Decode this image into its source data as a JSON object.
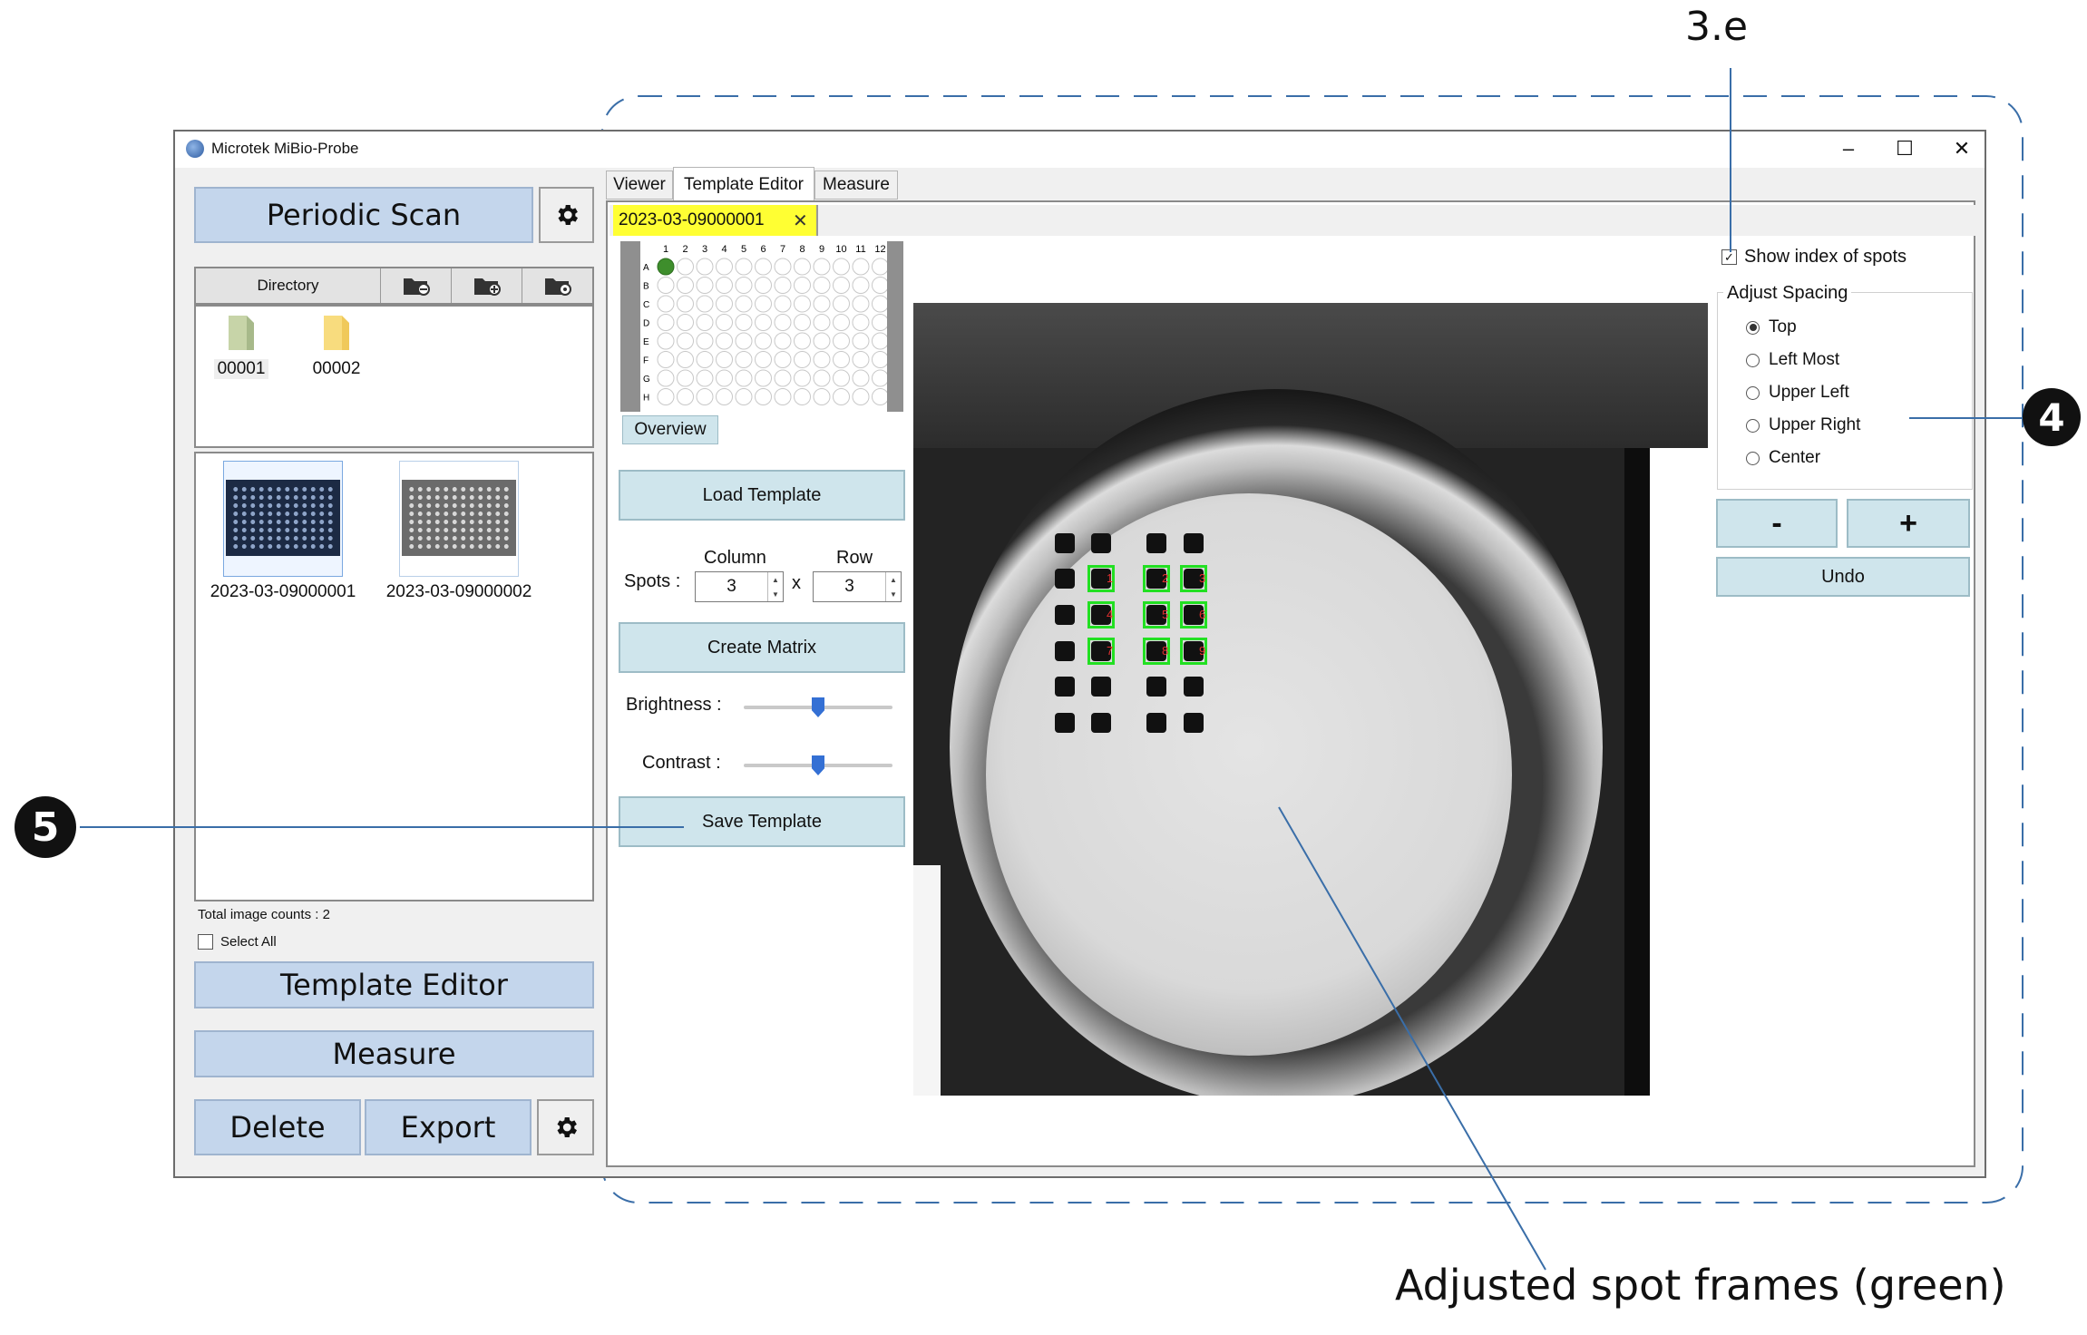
{
  "window": {
    "title": "Microtek MiBio-Probe",
    "controls": [
      "–",
      "☐",
      "✕"
    ]
  },
  "left_panel": {
    "periodic_scan_label": "Periodic Scan",
    "directory_label": "Directory",
    "folders": [
      "00001",
      "00002"
    ],
    "images": [
      "2023-03-09000001",
      "2023-03-09000002"
    ],
    "total_count_text": "Total image counts : 2",
    "select_all_label": "Select All",
    "template_editor_label": "Template Editor",
    "measure_label": "Measure",
    "delete_label": "Delete",
    "export_label": "Export"
  },
  "tabs": [
    "Viewer",
    "Template Editor",
    "Measure"
  ],
  "active_tab": "Template Editor",
  "doc_tab": {
    "label": "2023-03-09000001",
    "close": "✕"
  },
  "plate": {
    "column_numbers": [
      "1",
      "2",
      "3",
      "4",
      "5",
      "6",
      "7",
      "8",
      "9",
      "10",
      "11",
      "12"
    ],
    "row_letters": [
      "A",
      "B",
      "C",
      "D",
      "E",
      "F",
      "G",
      "H"
    ],
    "selected_well": "A1",
    "overview_label": "Overview"
  },
  "template_controls": {
    "load_template_label": "Load Template",
    "spots_label": "Spots :",
    "column_label": "Column",
    "row_label": "Row",
    "column_value": "3",
    "row_value": "3",
    "times_sign": "x",
    "create_matrix_label": "Create Matrix",
    "brightness_label": "Brightness :",
    "contrast_label": "Contrast :",
    "brightness_value": 0.5,
    "contrast_value": 0.5,
    "save_template_label": "Save Template"
  },
  "right_controls": {
    "show_index_label": "Show index of spots",
    "show_index_checked": true,
    "adjust_spacing_label": "Adjust Spacing",
    "spacing_options": [
      "Top",
      "Left Most",
      "Upper Left",
      "Upper Right",
      "Center"
    ],
    "spacing_selected": "Top",
    "minus_label": "-",
    "plus_label": "+",
    "undo_label": "Undo"
  },
  "spot_indices": [
    "1",
    "2",
    "3",
    "4",
    "5",
    "6",
    "7",
    "8",
    "9"
  ],
  "callouts": {
    "label_3e": "3.e",
    "label_4": "4",
    "label_5": "5",
    "adjusted_spots": "Adjusted spot frames (green)"
  },
  "colors": {
    "accent_blue": "#c4d6ec",
    "button_cyan": "#cfe5ec",
    "tab_highlight": "#ffff33",
    "spot_green": "#22e022",
    "index_red": "#e53030",
    "slider_blue": "#3470d4"
  }
}
